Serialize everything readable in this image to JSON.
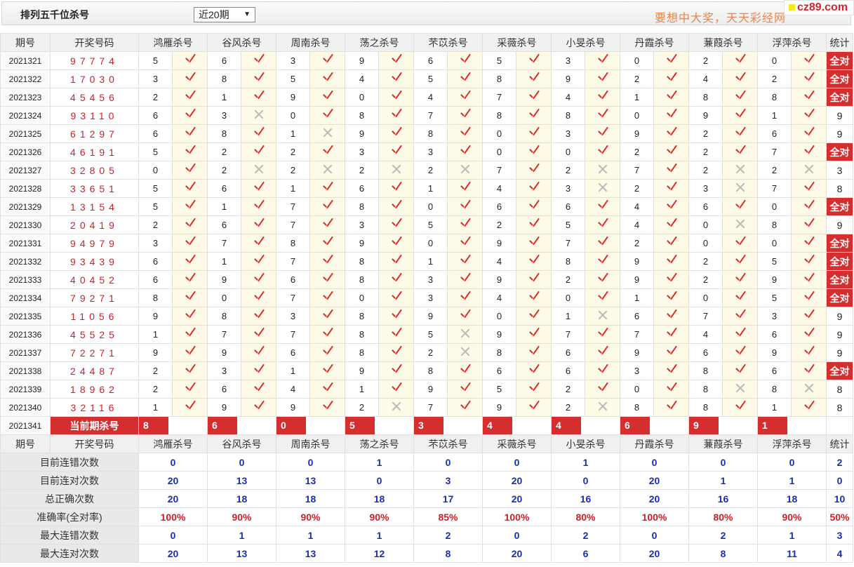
{
  "header": {
    "title": "排列五千位杀号",
    "period_select": "近20期",
    "slogan": "要想中大奖，天天彩经网",
    "site_logo": "cz89.com"
  },
  "columns": {
    "issue": "期号",
    "draw": "开奖号码",
    "experts": [
      "鸿雁杀号",
      "谷风杀号",
      "周南杀号",
      "荡之杀号",
      "芣苡杀号",
      "采薇杀号",
      "小旻杀号",
      "丹霞杀号",
      "蒹葭杀号",
      "浮萍杀号"
    ],
    "stat": "统计"
  },
  "rows": [
    {
      "issue": "2021321",
      "draw": "97774",
      "kills": [
        5,
        6,
        3,
        9,
        6,
        5,
        3,
        0,
        2,
        0
      ],
      "hits": [
        1,
        1,
        1,
        1,
        1,
        1,
        1,
        1,
        1,
        1
      ],
      "stat": "全对"
    },
    {
      "issue": "2021322",
      "draw": "17030",
      "kills": [
        3,
        8,
        5,
        4,
        5,
        8,
        9,
        2,
        4,
        2
      ],
      "hits": [
        1,
        1,
        1,
        1,
        1,
        1,
        1,
        1,
        1,
        1
      ],
      "stat": "全对"
    },
    {
      "issue": "2021323",
      "draw": "45456",
      "kills": [
        2,
        1,
        9,
        0,
        4,
        7,
        4,
        1,
        8,
        8
      ],
      "hits": [
        1,
        1,
        1,
        1,
        1,
        1,
        1,
        1,
        1,
        1
      ],
      "stat": "全对"
    },
    {
      "issue": "2021324",
      "draw": "93110",
      "kills": [
        6,
        3,
        0,
        8,
        7,
        8,
        8,
        0,
        9,
        1
      ],
      "hits": [
        1,
        0,
        1,
        1,
        1,
        1,
        1,
        1,
        1,
        1
      ],
      "stat": "9"
    },
    {
      "issue": "2021325",
      "draw": "61297",
      "kills": [
        6,
        8,
        1,
        9,
        8,
        0,
        3,
        9,
        2,
        6
      ],
      "hits": [
        1,
        1,
        0,
        1,
        1,
        1,
        1,
        1,
        1,
        1
      ],
      "stat": "9"
    },
    {
      "issue": "2021326",
      "draw": "46191",
      "kills": [
        5,
        2,
        2,
        3,
        3,
        0,
        0,
        2,
        2,
        7
      ],
      "hits": [
        1,
        1,
        1,
        1,
        1,
        1,
        1,
        1,
        1,
        1
      ],
      "stat": "全对"
    },
    {
      "issue": "2021327",
      "draw": "32805",
      "kills": [
        0,
        2,
        2,
        2,
        2,
        7,
        2,
        7,
        2,
        2
      ],
      "hits": [
        1,
        0,
        0,
        0,
        0,
        1,
        0,
        1,
        0,
        0
      ],
      "stat": "3"
    },
    {
      "issue": "2021328",
      "draw": "33651",
      "kills": [
        5,
        6,
        1,
        6,
        1,
        4,
        3,
        2,
        3,
        7
      ],
      "hits": [
        1,
        1,
        1,
        1,
        1,
        1,
        0,
        1,
        0,
        1
      ],
      "stat": "8"
    },
    {
      "issue": "2021329",
      "draw": "13154",
      "kills": [
        5,
        1,
        7,
        8,
        0,
        6,
        6,
        4,
        6,
        0
      ],
      "hits": [
        1,
        1,
        1,
        1,
        1,
        1,
        1,
        1,
        1,
        1
      ],
      "stat": "全对"
    },
    {
      "issue": "2021330",
      "draw": "20419",
      "kills": [
        2,
        6,
        7,
        3,
        5,
        2,
        5,
        4,
        0,
        8
      ],
      "hits": [
        1,
        1,
        1,
        1,
        1,
        1,
        1,
        1,
        0,
        1
      ],
      "stat": "9"
    },
    {
      "issue": "2021331",
      "draw": "94979",
      "kills": [
        3,
        7,
        8,
        9,
        0,
        9,
        7,
        2,
        0,
        0
      ],
      "hits": [
        1,
        1,
        1,
        1,
        1,
        1,
        1,
        1,
        1,
        1
      ],
      "stat": "全对"
    },
    {
      "issue": "2021332",
      "draw": "93439",
      "kills": [
        6,
        1,
        7,
        8,
        1,
        4,
        8,
        9,
        2,
        5
      ],
      "hits": [
        1,
        1,
        1,
        1,
        1,
        1,
        1,
        1,
        1,
        1
      ],
      "stat": "全对"
    },
    {
      "issue": "2021333",
      "draw": "40452",
      "kills": [
        6,
        9,
        6,
        8,
        3,
        9,
        2,
        9,
        2,
        9
      ],
      "hits": [
        1,
        1,
        1,
        1,
        1,
        1,
        1,
        1,
        1,
        1
      ],
      "stat": "全对"
    },
    {
      "issue": "2021334",
      "draw": "79271",
      "kills": [
        8,
        0,
        7,
        0,
        3,
        4,
        0,
        1,
        0,
        5
      ],
      "hits": [
        1,
        1,
        1,
        1,
        1,
        1,
        1,
        1,
        1,
        1
      ],
      "stat": "全对"
    },
    {
      "issue": "2021335",
      "draw": "11056",
      "kills": [
        9,
        8,
        3,
        8,
        9,
        0,
        1,
        6,
        7,
        3
      ],
      "hits": [
        1,
        1,
        1,
        1,
        1,
        1,
        0,
        1,
        1,
        1
      ],
      "stat": "9"
    },
    {
      "issue": "2021336",
      "draw": "45525",
      "kills": [
        1,
        7,
        7,
        8,
        5,
        9,
        7,
        7,
        4,
        6
      ],
      "hits": [
        1,
        1,
        1,
        1,
        0,
        1,
        1,
        1,
        1,
        1
      ],
      "stat": "9"
    },
    {
      "issue": "2021337",
      "draw": "72271",
      "kills": [
        9,
        9,
        6,
        8,
        2,
        8,
        6,
        9,
        6,
        9
      ],
      "hits": [
        1,
        1,
        1,
        1,
        0,
        1,
        1,
        1,
        1,
        1
      ],
      "stat": "9"
    },
    {
      "issue": "2021338",
      "draw": "24487",
      "kills": [
        2,
        3,
        1,
        9,
        8,
        6,
        6,
        3,
        8,
        6
      ],
      "hits": [
        1,
        1,
        1,
        1,
        1,
        1,
        1,
        1,
        1,
        1
      ],
      "stat": "全对"
    },
    {
      "issue": "2021339",
      "draw": "18962",
      "kills": [
        2,
        6,
        4,
        1,
        9,
        5,
        2,
        0,
        8,
        8
      ],
      "hits": [
        1,
        1,
        1,
        1,
        1,
        1,
        1,
        1,
        0,
        0
      ],
      "stat": "8"
    },
    {
      "issue": "2021340",
      "draw": "32116",
      "kills": [
        1,
        9,
        9,
        2,
        7,
        9,
        2,
        8,
        8,
        1
      ],
      "hits": [
        1,
        1,
        1,
        0,
        1,
        1,
        0,
        1,
        1,
        1
      ],
      "stat": "8"
    }
  ],
  "current": {
    "issue": "2021341",
    "label": "当前期杀号",
    "kills": [
      8,
      6,
      0,
      5,
      3,
      4,
      4,
      6,
      9,
      1
    ]
  },
  "summary": [
    {
      "label": "目前连错次数",
      "values": [
        "0",
        "0",
        "0",
        "1",
        "0",
        "0",
        "1",
        "0",
        "0",
        "0"
      ],
      "stat": "2"
    },
    {
      "label": "目前连对次数",
      "values": [
        "20",
        "13",
        "13",
        "0",
        "3",
        "20",
        "0",
        "20",
        "1",
        "1"
      ],
      "stat": "0"
    },
    {
      "label": "总正确次数",
      "values": [
        "20",
        "18",
        "18",
        "18",
        "17",
        "20",
        "16",
        "20",
        "16",
        "18"
      ],
      "stat": "10"
    },
    {
      "label": "准确率(全对率)",
      "values": [
        "100%",
        "90%",
        "90%",
        "90%",
        "85%",
        "100%",
        "80%",
        "100%",
        "80%",
        "90%"
      ],
      "stat": "50%",
      "rate": true
    },
    {
      "label": "最大连错次数",
      "values": [
        "0",
        "1",
        "1",
        "1",
        "2",
        "0",
        "2",
        "0",
        "2",
        "1"
      ],
      "stat": "3"
    },
    {
      "label": "最大连对次数",
      "values": [
        "20",
        "13",
        "13",
        "12",
        "8",
        "20",
        "6",
        "20",
        "8",
        "11"
      ],
      "stat": "4"
    }
  ]
}
